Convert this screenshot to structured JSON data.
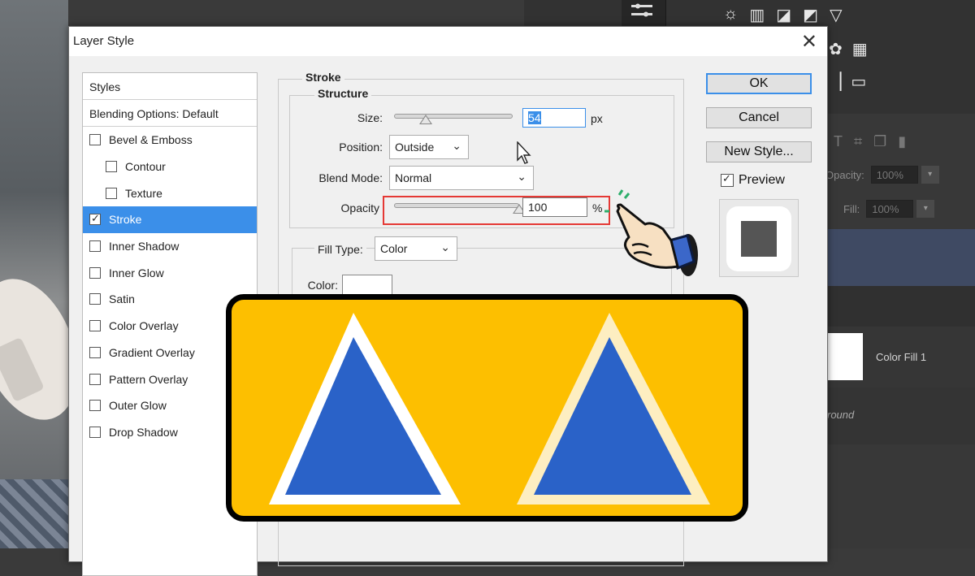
{
  "dialog": {
    "title": "Layer Style",
    "close_glyph": "✕"
  },
  "styles_list": {
    "header": "Styles",
    "blending": "Blending Options: Default",
    "items": [
      {
        "label": "Bevel & Emboss",
        "checked": false,
        "indent": false
      },
      {
        "label": "Contour",
        "checked": false,
        "indent": true
      },
      {
        "label": "Texture",
        "checked": false,
        "indent": true
      },
      {
        "label": "Stroke",
        "checked": true,
        "indent": false,
        "active": true
      },
      {
        "label": "Inner Shadow",
        "checked": false,
        "indent": false
      },
      {
        "label": "Inner Glow",
        "checked": false,
        "indent": false
      },
      {
        "label": "Satin",
        "checked": false,
        "indent": false
      },
      {
        "label": "Color Overlay",
        "checked": false,
        "indent": false
      },
      {
        "label": "Gradient Overlay",
        "checked": false,
        "indent": false
      },
      {
        "label": "Pattern Overlay",
        "checked": false,
        "indent": false
      },
      {
        "label": "Outer Glow",
        "checked": false,
        "indent": false
      },
      {
        "label": "Drop Shadow",
        "checked": false,
        "indent": false
      }
    ]
  },
  "stroke": {
    "group_label": "Stroke",
    "structure_label": "Structure",
    "size_label": "Size:",
    "size_value": "54",
    "size_unit": "px",
    "size_slider": 0.27,
    "position_label": "Position:",
    "position_value": "Outside",
    "blend_label": "Blend Mode:",
    "blend_value": "Normal",
    "opacity_label": "Opacity",
    "opacity_value": "100",
    "opacity_unit": "%",
    "opacity_slider": 1.0,
    "fill_type_label": "Fill Type:",
    "fill_type_value": "Color",
    "color_label": "Color:"
  },
  "buttons": {
    "ok": "OK",
    "cancel": "Cancel",
    "new_style": "New Style...",
    "preview": "Preview"
  },
  "ps_panel": {
    "opacity_label": "Opacity:",
    "opacity_value": "100%",
    "fill_label": "Fill:",
    "fill_value": "100%",
    "layer_name": "Color Fill 1",
    "bg_layer_partial": "round"
  },
  "colors": {
    "accent": "#3b8fe9",
    "card": "#fdbf00",
    "triangle": "#2a62c8",
    "stroke_white": "#ffffff",
    "stroke_cream": "#fdeec1",
    "highlight_box": "#e53935"
  }
}
